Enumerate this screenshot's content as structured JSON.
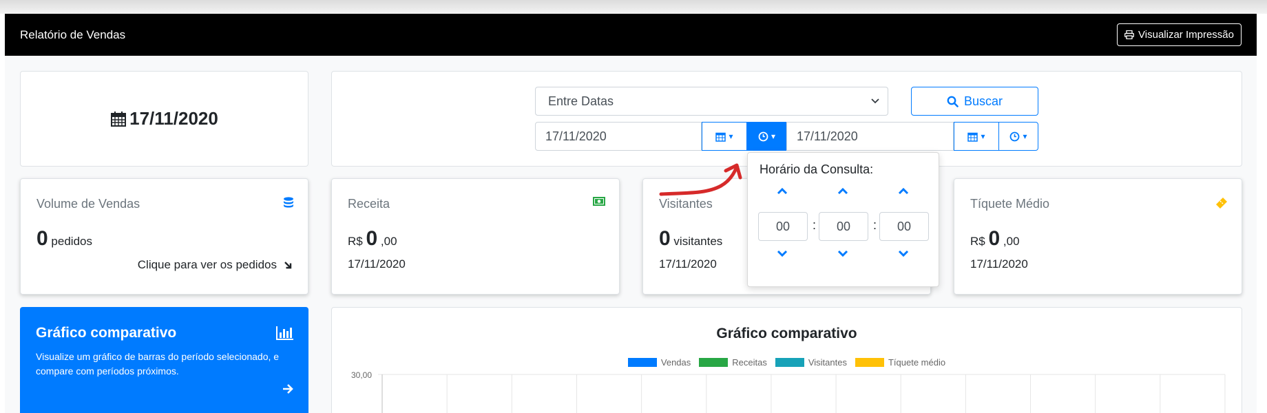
{
  "header": {
    "title": "Relatório de Vendas",
    "print_button": "Visualizar Impressão"
  },
  "current_date": "17/11/2020",
  "filter": {
    "period_select": "Entre Datas",
    "search_button": "Buscar",
    "start_date": "17/11/2020",
    "end_date": "17/11/2020"
  },
  "time_picker": {
    "title": "Horário da Consulta:",
    "hours": "00",
    "minutes": "00",
    "seconds": "00",
    "separator": ":"
  },
  "stats": [
    {
      "title": "Volume de Vendas",
      "value": "0",
      "suffix": "pedidos",
      "link": "Clique para ver os pedidos",
      "icon": "database-icon",
      "icon_color": "#007bff"
    },
    {
      "title": "Receita",
      "prefix": "R$",
      "value": "0",
      "suffix": ",00",
      "date": "17/11/2020",
      "icon": "money-icon",
      "icon_color": "#28a745"
    },
    {
      "title": "Visitantes",
      "value": "0",
      "suffix": "visitantes",
      "date": "17/11/2020"
    },
    {
      "title": "Tíquete Médio",
      "prefix": "R$",
      "value": "0",
      "suffix": ",00",
      "date": "17/11/2020",
      "icon": "ticket-icon",
      "icon_color": "#ffc107"
    }
  ],
  "comparison_card": {
    "title": "Gráfico comparativo",
    "description": "Visualize um gráfico de barras do período selecionado, e compare com períodos próximos.",
    "background": "#007bff"
  },
  "chart_data": {
    "type": "bar",
    "title": "Gráfico comparativo",
    "series": [
      {
        "name": "Vendas",
        "color": "#007bff",
        "values": []
      },
      {
        "name": "Receitas",
        "color": "#28a745",
        "values": []
      },
      {
        "name": "Visitantes",
        "color": "#17a2b8",
        "values": []
      },
      {
        "name": "Tíquete médio",
        "color": "#ffc107",
        "values": []
      }
    ],
    "y_tick_top": "30,00",
    "ylim": [
      0,
      30
    ],
    "grid": true,
    "legend_position": "top-center"
  }
}
